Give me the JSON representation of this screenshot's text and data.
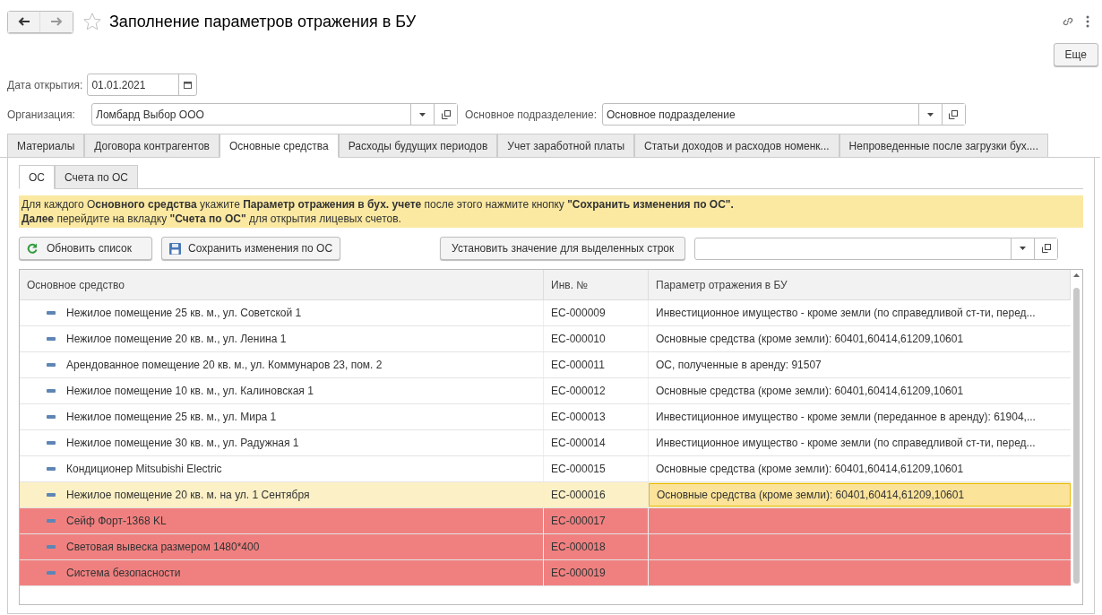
{
  "window": {
    "title": "Заполнение параметров отражения в БУ",
    "more_button": "Еще"
  },
  "form": {
    "date": {
      "label": "Дата открытия:",
      "value": "01.01.2021"
    },
    "organization": {
      "label": "Организация:",
      "value": "Ломбард Выбор ООО"
    },
    "division": {
      "label": "Основное подразделение:",
      "value": "Основное подразделение"
    }
  },
  "tabs": [
    {
      "label": "Материалы",
      "selected": false
    },
    {
      "label": "Договора контрагентов",
      "selected": false
    },
    {
      "label": "Основные средства",
      "selected": true
    },
    {
      "label": "Расходы будущих периодов",
      "selected": false
    },
    {
      "label": "Учет заработной платы",
      "selected": false
    },
    {
      "label": "Статьи доходов и расходов номенк...",
      "selected": false
    },
    {
      "label": "Непроведенные после загрузки бух....",
      "selected": false
    }
  ],
  "subtabs": [
    {
      "label": "ОС",
      "selected": true
    },
    {
      "label": "Счета по ОС",
      "selected": false
    }
  ],
  "info": [
    "Для каждого О**сновного средства** укажите **Параметр отражения в бух. учете** после этого нажмите кнопку **\"Сохранить изменения по ОС\".**",
    "**Далее** перейдите на вкладку **\"Счета по ОС\"** для открытия лицевых счетов."
  ],
  "toolbar": {
    "refresh": "Обновить список",
    "save": "Сохранить изменения по ОС",
    "set_value": "Установить значение для выделенных строк"
  },
  "table": {
    "columns": [
      "Основное средство",
      "Инв. №",
      "Параметр отражения в БУ"
    ],
    "rows": [
      {
        "name": "Нежилое помещение 25 кв. м., ул. Советской 1",
        "inv": "ЕС-000009",
        "param": "Инвестиционное имущество - кроме земли (по справедливой ст-ти, перед...",
        "selected": false,
        "error": false
      },
      {
        "name": "Нежилое помещение 20 кв. м., ул. Ленина 1",
        "inv": "ЕС-000010",
        "param": "Основные средства (кроме земли): 60401,60414,61209,10601",
        "selected": false,
        "error": false
      },
      {
        "name": "Арендованное помещение 20 кв. м., ул. Коммунаров 23, пом. 2",
        "inv": "ЕС-000011",
        "param": "ОС, полученные в аренду: 91507",
        "selected": false,
        "error": false
      },
      {
        "name": "Нежилое помещение 10 кв. м., ул. Калиновская 1",
        "inv": "ЕС-000012",
        "param": "Основные средства (кроме земли): 60401,60414,61209,10601",
        "selected": false,
        "error": false
      },
      {
        "name": "Нежилое помещение 25 кв. м., ул. Мира 1",
        "inv": "ЕС-000013",
        "param": "Инвестиционное имущество - кроме земли (переданное в аренду): 61904,...",
        "selected": false,
        "error": false
      },
      {
        "name": "Нежилое помещение 30 кв. м., ул. Радужная 1",
        "inv": "ЕС-000014",
        "param": "Инвестиционное имущество - кроме земли (по справедливой ст-ти, перед...",
        "selected": false,
        "error": false
      },
      {
        "name": "Кондиционер  Mitsubishi Electric",
        "inv": "ЕС-000015",
        "param": "Основные средства (кроме земли): 60401,60414,61209,10601",
        "selected": false,
        "error": false
      },
      {
        "name": "Нежилое помещение 20 кв. м. на ул. 1 Сентября",
        "inv": "ЕС-000016",
        "param": "Основные средства (кроме земли): 60401,60414,61209,10601",
        "selected": true,
        "error": false
      },
      {
        "name": "Сейф Форт-1368 KL",
        "inv": "ЕС-000017",
        "selected": false,
        "error": true
      },
      {
        "name": "Световая вывеска размером 1480*400",
        "inv": "ЕС-000018",
        "selected": false,
        "error": true
      },
      {
        "name": "Система безопасности",
        "inv": "ЕС-000019",
        "selected": false,
        "error": true
      }
    ]
  }
}
